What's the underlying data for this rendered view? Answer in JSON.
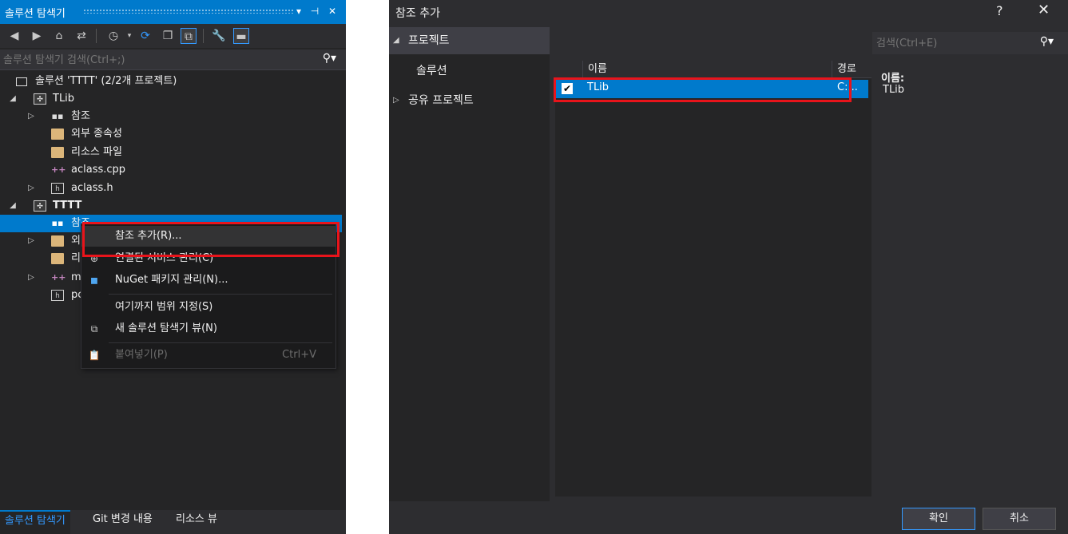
{
  "solution_explorer": {
    "title": "솔루션 탐색기",
    "title_buttons": [
      "▾",
      "⊣",
      "✕"
    ],
    "search": {
      "placeholder": "솔루션 탐색기 검색(Ctrl+;)"
    },
    "tree": [
      {
        "label": "솔루션 'TTTT' (2/2개 프로젝트)"
      },
      {
        "label": "TLib"
      },
      {
        "label": "참조"
      },
      {
        "label": "외부 종속성"
      },
      {
        "label": "리소스 파일"
      },
      {
        "label": "aclass.cpp"
      },
      {
        "label": "aclass.h"
      },
      {
        "label": "TTTT"
      },
      {
        "label": "참조"
      },
      {
        "label": "외"
      },
      {
        "label": "리"
      },
      {
        "label": "m"
      },
      {
        "label": "pc"
      }
    ],
    "context_menu": [
      {
        "label": "참조 추가(R)...",
        "shortcut": ""
      },
      {
        "label": "연결된 서비스 관리(C)",
        "shortcut": ""
      },
      {
        "label": "NuGet 패키지 관리(N)...",
        "shortcut": ""
      },
      {
        "label": "여기까지 범위 지정(S)",
        "shortcut": ""
      },
      {
        "label": "새 솔루션 탐색기 뷰(N)",
        "shortcut": ""
      },
      {
        "label": "붙여넣기(P)",
        "shortcut": "Ctrl+V"
      }
    ],
    "bottom_tabs": [
      "솔루션 탐색기",
      "Git 변경 내용",
      "리소스 뷰"
    ]
  },
  "add_reference_dialog": {
    "title": "참조 추가",
    "help": "?",
    "close": "✕",
    "nav": {
      "projects": "프로젝트",
      "solution": "솔루션",
      "shared_projects": "공유 프로젝트"
    },
    "search_placeholder": "검색(Ctrl+E)",
    "columns": {
      "name": "이름",
      "path": "경로"
    },
    "rows": [
      {
        "checked": true,
        "name": "TLib",
        "path": "C:..."
      }
    ],
    "detail": {
      "name_label": "이름:",
      "name_value": "TLib"
    },
    "buttons": {
      "ok": "확인",
      "cancel": "취소"
    }
  },
  "colors": {
    "accent": "#007acc",
    "highlight_box": "#e8141b",
    "bg_dark": "#252526"
  }
}
